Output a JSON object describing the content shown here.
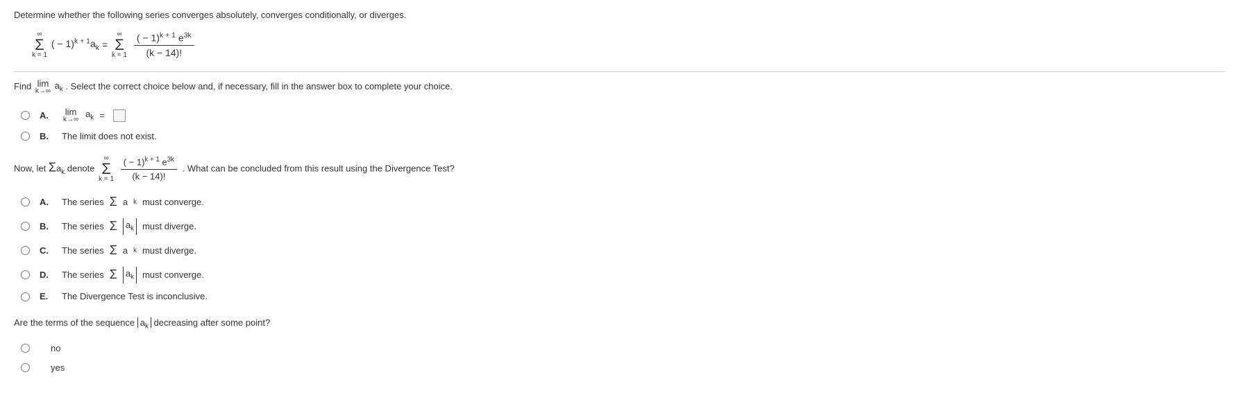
{
  "problem": {
    "statement": "Determine whether the following series converges absolutely, converges conditionally, or diverges.",
    "sum_upper": "∞",
    "sum_lower": "k = 1",
    "term_left": "( − 1)",
    "exp_left": "k + 1",
    "a_k": "a",
    "a_k_sub": "k",
    "equals": " = ",
    "frac_num_prefix": "( − 1)",
    "frac_num_exp": "k + 1",
    "frac_num_e": " e",
    "frac_num_e_exp": "3k",
    "frac_den": "(k − 14)!"
  },
  "q1": {
    "prompt_pre": "Find ",
    "lim": "lim",
    "lim_under": "k→∞",
    "ak": "a",
    "ak_sub": "k",
    "prompt_post": ". Select the correct choice below and, if necessary, fill in the answer box to complete your choice.",
    "optA_label": "A.",
    "optA_lim": "lim",
    "optA_under": "k→∞",
    "optA_ak": "a",
    "optA_ak_sub": "k",
    "optA_eq": " = ",
    "optB_label": "B.",
    "optB_text": "The limit does not exist."
  },
  "q2": {
    "now_let": "Now, let ",
    "sigma_inline": "Σ",
    "ak": "a",
    "ak_sub": "k",
    "denote": " denote ",
    "sum_upper": "∞",
    "sum_lower": "k = 1",
    "frac_num_prefix": "( − 1)",
    "frac_num_exp": "k + 1",
    "frac_num_e": " e",
    "frac_num_e_exp": "3k",
    "frac_den": "(k − 14)!",
    "post": ". What can be concluded from this result using the Divergence Test?",
    "optA_label": "A.",
    "optA_text_pre": "The series ",
    "optA_sigma": "Σ",
    "optA_ak": "a",
    "optA_ak_sub": "k",
    "optA_text_post": " must converge.",
    "optB_label": "B.",
    "optB_text_pre": "The series ",
    "optB_sigma": "Σ",
    "optB_ak": "a",
    "optB_ak_sub": "k",
    "optB_text_post": " must diverge.",
    "optC_label": "C.",
    "optC_text_pre": "The series ",
    "optC_sigma": "Σ",
    "optC_ak": "a",
    "optC_ak_sub": "k",
    "optC_text_post": " must diverge.",
    "optD_label": "D.",
    "optD_text_pre": "The series ",
    "optD_sigma": "Σ",
    "optD_ak": "a",
    "optD_ak_sub": "k",
    "optD_text_post": " must converge.",
    "optE_label": "E.",
    "optE_text": "The Divergence Test is inconclusive."
  },
  "q3": {
    "text_pre": "Are the terms of the sequence ",
    "ak": "a",
    "ak_sub": "k",
    "text_post": " decreasing after some point?",
    "opt_no": "no",
    "opt_yes": "yes"
  }
}
